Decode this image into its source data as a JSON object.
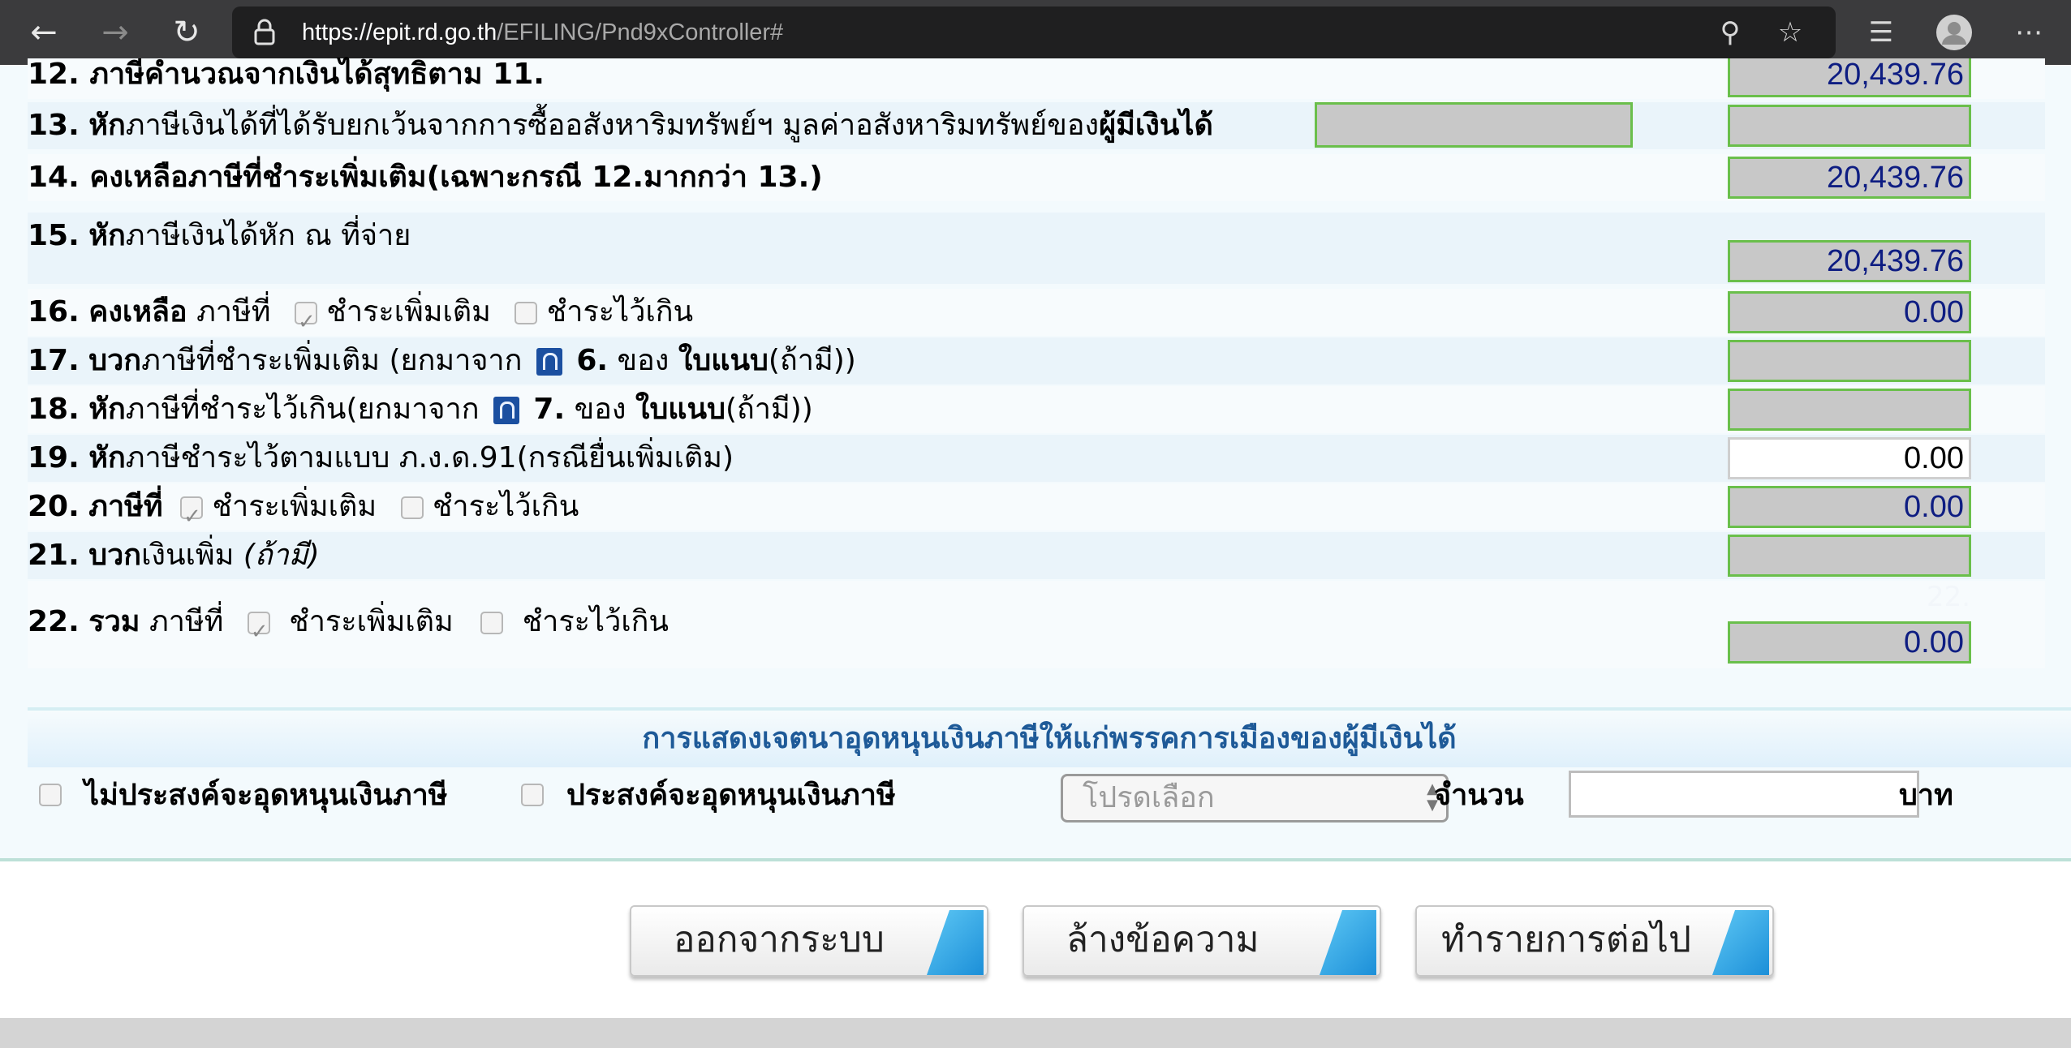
{
  "browser": {
    "url_host": "https://epit.rd.go.th",
    "url_path": "/EFILING/Pnd9xController#",
    "icons": [
      "back-arrow-icon",
      "forward-arrow-icon",
      "reload-icon",
      "lock-icon",
      "zoom-icon",
      "star-icon",
      "favorites-list-icon",
      "profile-icon",
      "more-icon"
    ]
  },
  "rows": {
    "r12": {
      "num": "12.",
      "label": "ภาษีคำนวณจากเงินได้สุทธิตาม 11.",
      "value": "20,439.76"
    },
    "r13": {
      "num": "13.",
      "bold": "หัก",
      "label": "ภาษีเงินได้ที่ได้รับยกเว้นจากการซื้ออสังหาริมทรัพย์ฯ มูลค่าอสังหาริมทรัพย์ของ",
      "bold2": "ผู้มีเงินได้",
      "value": ""
    },
    "r14": {
      "num": "14.",
      "label": "คงเหลือภาษีที่ชำระเพิ่มเติม(เฉพาะกรณี 12.มากกว่า 13.)",
      "value": "20,439.76"
    },
    "r15": {
      "num": "15.",
      "bold": "หัก",
      "label": "ภาษีเงินได้หัก ณ ที่จ่าย",
      "value": "20,439.76"
    },
    "r16": {
      "num": "16.",
      "bold": "คงเหลือ",
      "label": "ภาษีที่",
      "opt1": "ชำระเพิ่มเติม",
      "opt2": "ชำระไว้เกิน",
      "value": "0.00"
    },
    "r17": {
      "num": "17.",
      "bold": "บวก",
      "label": "ภาษีที่ชำระเพิ่มเติม (ยกมาจาก",
      "ref_num": "6.",
      "ref_of": "ของ",
      "ref_doc": "ใบแนบ",
      "ref_tail": "(ถ้ามี))",
      "value": ""
    },
    "r18": {
      "num": "18.",
      "bold": "หัก",
      "label": "ภาษีที่ชำระไว้เกิน(ยกมาจาก",
      "ref_num": "7.",
      "ref_of": "ของ",
      "ref_doc": "ใบแนบ",
      "ref_tail": "(ถ้ามี))",
      "value": ""
    },
    "r19": {
      "num": "19.",
      "bold": "หัก",
      "label": "ภาษีชำระไว้ตามแบบ ภ.ง.ด.91(กรณียื่นเพิ่มเติม)",
      "value": "0.00"
    },
    "r20": {
      "num": "20.",
      "bold": "ภาษีที่",
      "opt1": "ชำระเพิ่มเติม",
      "opt2": "ชำระไว้เกิน",
      "value": "0.00"
    },
    "r21": {
      "num": "21.",
      "bold": "บวก",
      "label": "เงินเพิ่ม",
      "italic": "(ถ้ามี)",
      "value": ""
    },
    "r22": {
      "num": "22.",
      "bold": "รวม",
      "label": "ภาษีที่",
      "opt1": "ชำระเพิ่มเติม",
      "opt2": "ชำระไว้เกิน",
      "value": "0.00",
      "ghost": "22."
    }
  },
  "checkboxes": {
    "r16_opt1": true,
    "r16_opt2": false,
    "r20_opt1": true,
    "r20_opt2": false,
    "r22_opt1": true,
    "r22_opt2": false
  },
  "donation": {
    "heading": "การแสดงเจตนาอุดหนุนเงินภาษีให้แก่พรรคการเมืองของผู้มีเงินได้",
    "no_support": "ไม่ประสงค์จะอุดหนุนเงินภาษี",
    "support": "ประสงค์จะอุดหนุนเงินภาษี",
    "select_placeholder": "โปรดเลือก",
    "amount_label": "จำนวน",
    "unit": "บาท"
  },
  "buttons": {
    "logout": "ออกจากระบบ",
    "clear": "ล้างข้อความ",
    "next": "ทำรายการต่อไป"
  },
  "colors": {
    "accent_border": "#6abf4b",
    "value_text": "#0e1d82",
    "heading_text": "#1e5a98"
  }
}
